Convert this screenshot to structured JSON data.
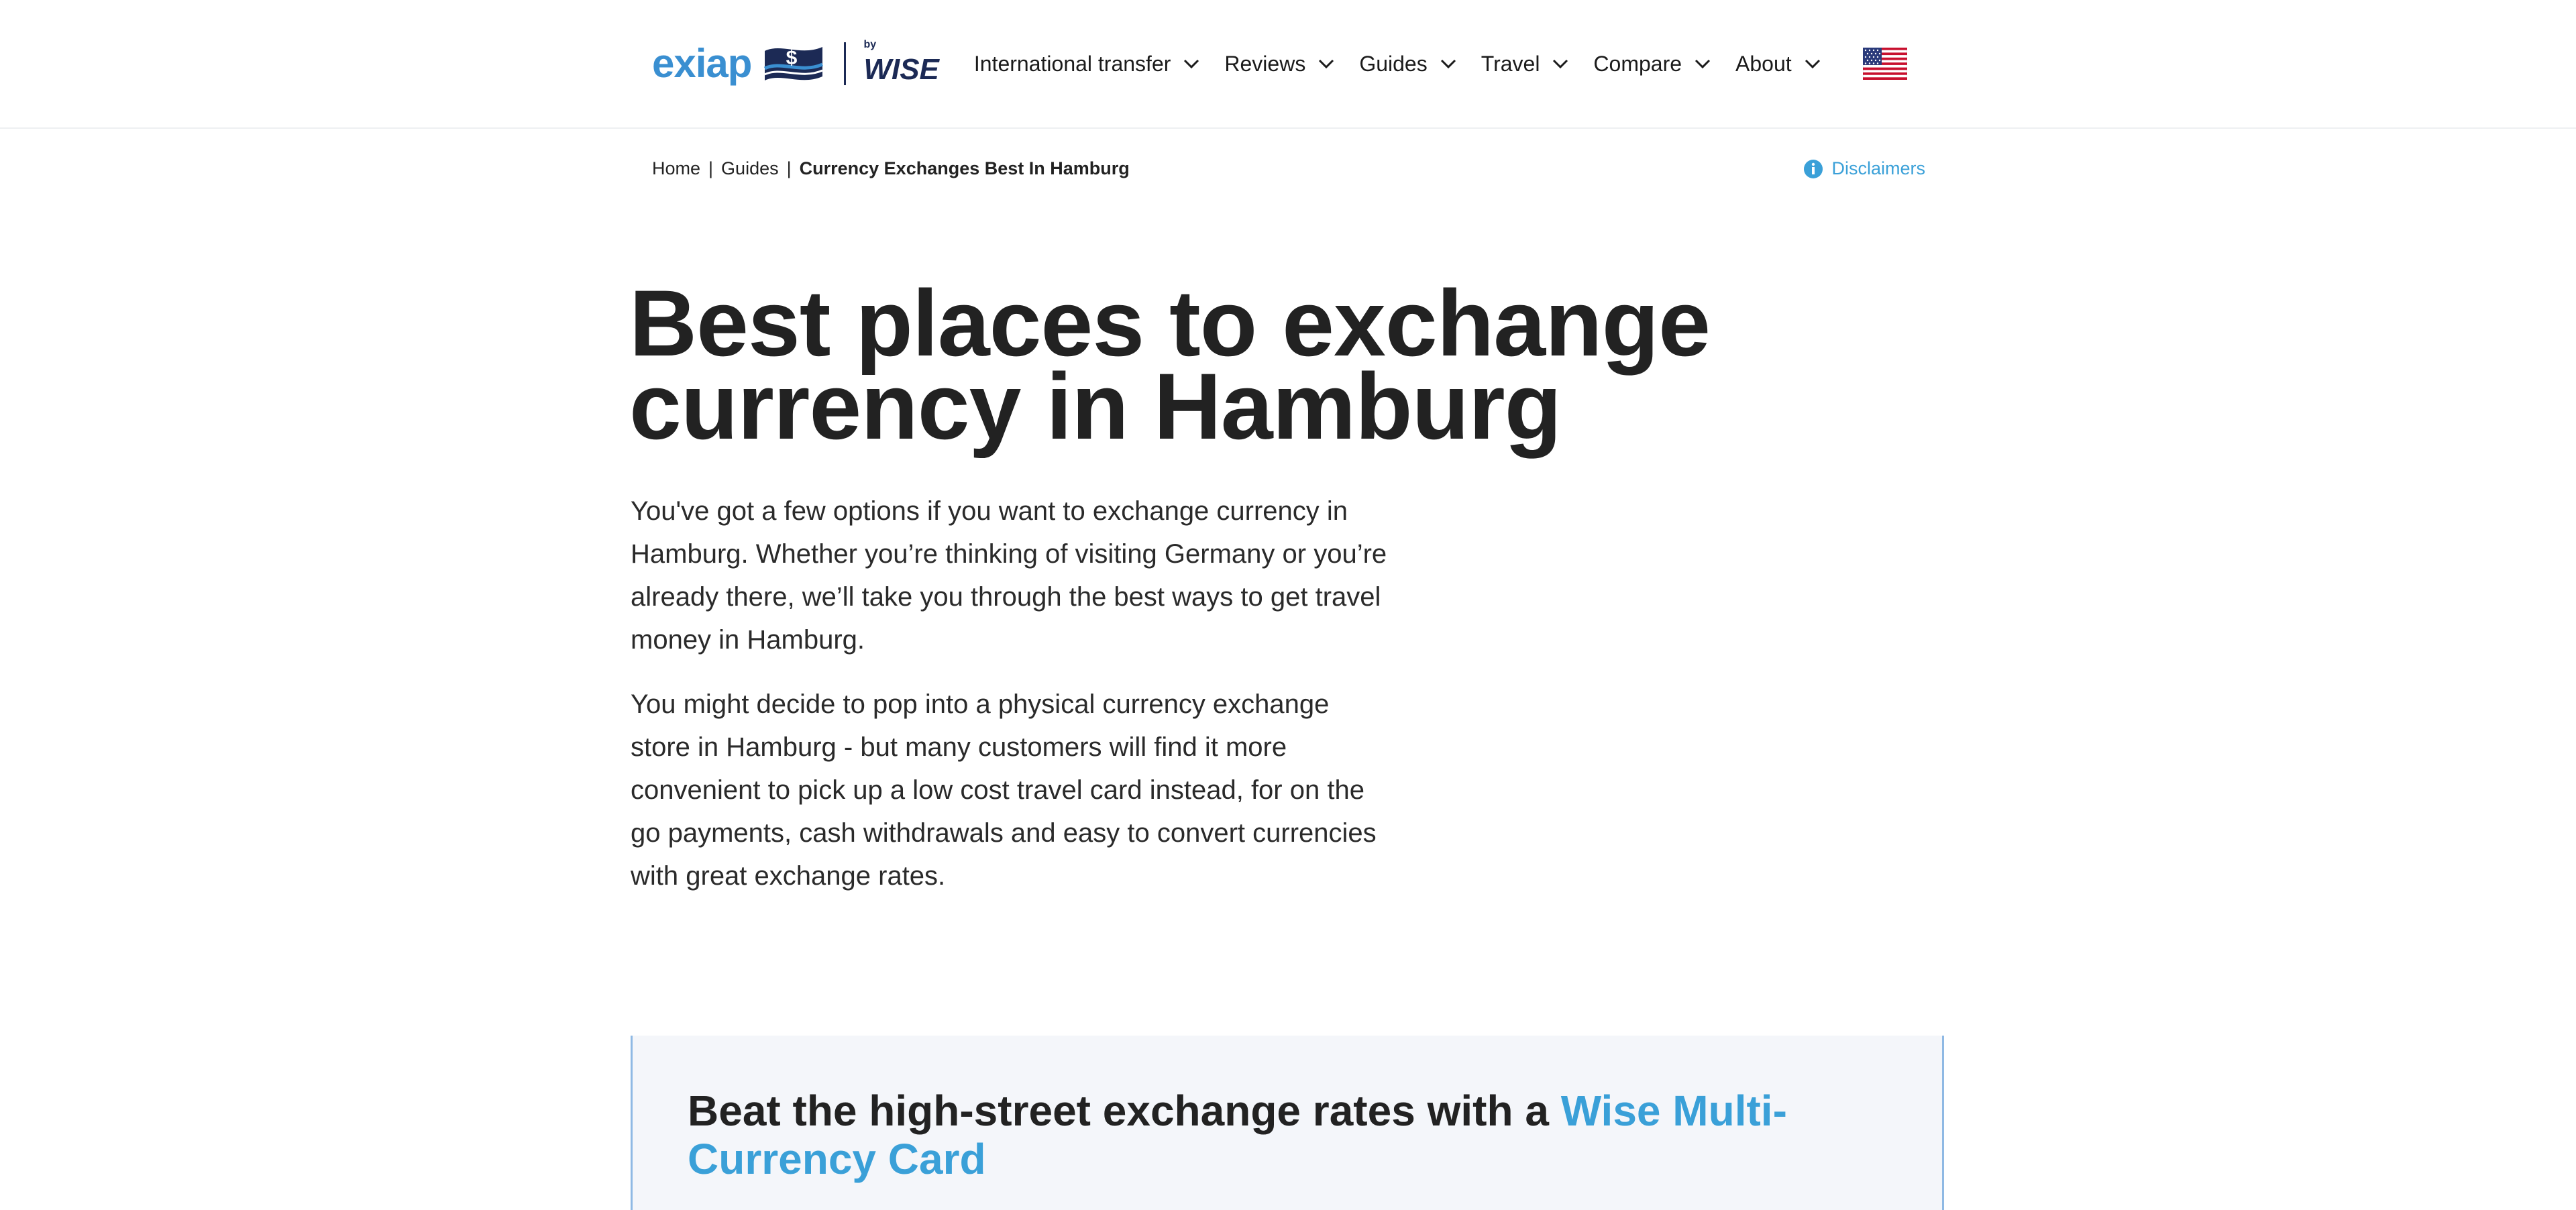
{
  "header": {
    "logo": {
      "wordmark": "exiap",
      "partner_by": "by",
      "partner_name": "WISE",
      "flag_icon": "dollar-flag-icon"
    },
    "nav": [
      {
        "label": "International transfer",
        "icon": "chevron-down-icon"
      },
      {
        "label": "Reviews",
        "icon": "chevron-down-icon"
      },
      {
        "label": "Guides",
        "icon": "chevron-down-icon"
      },
      {
        "label": "Travel",
        "icon": "chevron-down-icon"
      },
      {
        "label": "Compare",
        "icon": "chevron-down-icon"
      },
      {
        "label": "About",
        "icon": "chevron-down-icon"
      }
    ],
    "locale_icon": "us-flag-icon"
  },
  "breadcrumb": {
    "items": [
      {
        "label": "Home"
      },
      {
        "label": "Guides"
      },
      {
        "label": "Currency Exchanges Best In Hamburg"
      }
    ],
    "separator": "|"
  },
  "disclaimers": {
    "label": "Disclaimers",
    "icon": "info-icon"
  },
  "main": {
    "title": "Best places to exchange currency in Hamburg",
    "paragraphs": [
      "You've got a few options if you want to exchange currency in Hamburg. Whether you’re thinking of visiting Germany or you’re already there, we’ll take you through the best ways to get travel money in Hamburg.",
      "You might decide to pop into a physical currency exchange store in Hamburg - but many customers will find it more convenient to pick up a low cost travel card instead, for on the go payments, cash withdrawals and easy to convert currencies with great exchange rates."
    ]
  },
  "promo": {
    "title_prefix": "Beat the high-street exchange rates with a",
    "title_link": "Wise Multi-Currency Card"
  },
  "colors": {
    "brand_blue": "#3a8fd1",
    "link_blue": "#3aa0d8",
    "navy": "#1c2a55",
    "text": "#222222",
    "promo_bg": "#f4f6fa"
  }
}
